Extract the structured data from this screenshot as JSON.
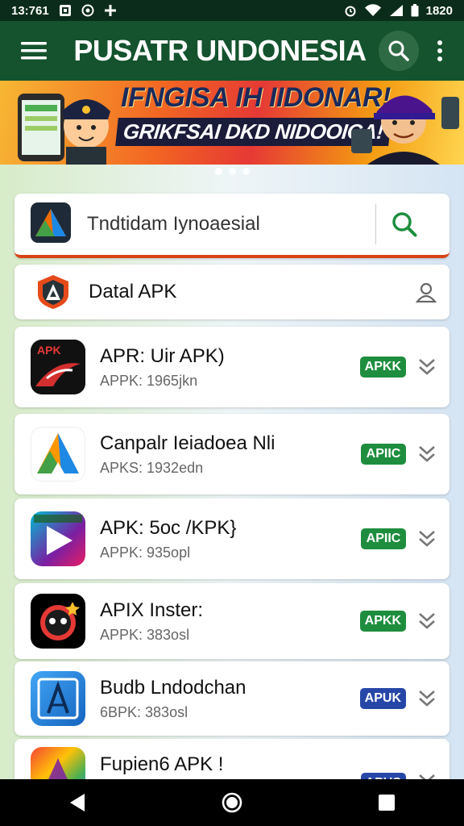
{
  "status_bar": {
    "time": "13:761",
    "battery": "1820",
    "icons": [
      "photo-icon",
      "record-icon",
      "plus-icon",
      "alarm-icon",
      "wifi-icon",
      "signal-icon",
      "battery-icon"
    ]
  },
  "app_bar": {
    "title": "PUSATR UNDONESIA",
    "color": "#14532d"
  },
  "banner": {
    "line1": "IFNGISA IH IIDONAR!",
    "line2": "GRIKFSAI DKD NIDOOICA!"
  },
  "search": {
    "value": "Tndtidam Iynoaesial",
    "placeholder": ""
  },
  "data_card": {
    "title": "Datal APK"
  },
  "apps": [
    {
      "name": "APR: Uir APK)",
      "size": "APPK: 1965jkn",
      "badge": "APKK",
      "badge_color": "#1e8e3e",
      "icon": "apk-mask-icon"
    },
    {
      "name": "Canpalr Ieiadoea Nli",
      "size": "APKS: 1932edn",
      "badge": "APIIC",
      "badge_color": "#1e8e3e",
      "icon": "gradient-a-icon"
    },
    {
      "name": "APK: 5oc /KPK}",
      "size": "APPK: 935opl",
      "badge": "APIIC",
      "badge_color": "#1e8e3e",
      "icon": "play-triangle-icon"
    },
    {
      "name": "APIX Inster:",
      "size": "APPK: 383osl",
      "badge": "APKK",
      "badge_color": "#1e8e3e",
      "icon": "robot-face-icon"
    },
    {
      "name": "Budb Lndodchan",
      "size": "6BPK: 383osl",
      "badge": "APUK",
      "badge_color": "#2747a8",
      "icon": "blue-a-icon"
    },
    {
      "name": "Fupien6 APK !",
      "size": "",
      "badge": "APUS",
      "badge_color": "#2747a8",
      "icon": "colorful-icon"
    }
  ]
}
